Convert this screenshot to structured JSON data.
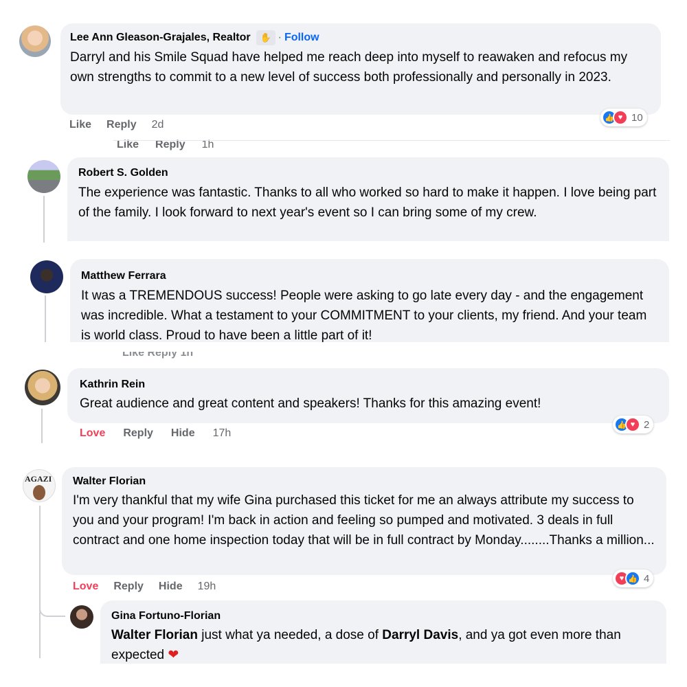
{
  "colors": {
    "like_blue": "#1877f2",
    "love_red": "#f33e58",
    "bubble_bg": "#f0f2f5",
    "follow_blue": "#0866ff"
  },
  "comments": [
    {
      "author": "Lee Ann Gleason-Grajales, Realtor",
      "badge_icon": "top-fan-badge-icon",
      "follow": "Follow",
      "text": "Darryl and his Smile Squad have helped me reach deep into myself to reawaken and refocus my own strengths to commit to a new level of success both professionally and personally in 2023.",
      "actions": {
        "like": "Like",
        "reply": "Reply",
        "time": "2d"
      },
      "reactions": {
        "icons": [
          "like-icon",
          "love-icon"
        ],
        "count": "10"
      },
      "sub_actions": {
        "like": "Like",
        "reply": "Reply",
        "time": "1h"
      }
    },
    {
      "author": "Robert S. Golden",
      "text": "The experience was fantastic. Thanks to all who worked so hard to make it happen. I love being part of the family. I look forward to next year's event so I can bring some of my crew."
    },
    {
      "author": "Matthew Ferrara",
      "text": "It was a TREMENDOUS success! People were asking to go late every day - and the engagement was incredible. What a testament to your COMMITMENT to your clients, my friend. And your team is world class. Proud to have been a little part of it!",
      "partial_actions": "Like Reply 1h"
    },
    {
      "author": "Kathrin Rein",
      "text": "Great audience and great content and speakers! Thanks for this amazing event!",
      "actions": {
        "love": "Love",
        "reply": "Reply",
        "hide": "Hide",
        "time": "17h"
      },
      "reactions": {
        "icons": [
          "like-icon",
          "love-icon"
        ],
        "count": "2"
      }
    },
    {
      "author": "Walter Florian",
      "text": "I'm very thankful that my wife Gina purchased this ticket for me an always attribute my success to you and your program! I'm back in action and feeling so pumped and motivated. 3 deals in full contract and one home inspection today that will be in full contract by Monday........Thanks a million...",
      "actions": {
        "love": "Love",
        "reply": "Reply",
        "hide": "Hide",
        "time": "19h"
      },
      "reactions": {
        "icons": [
          "love-icon",
          "like-icon"
        ],
        "count": "4"
      },
      "avatar_text": "AGAZI"
    },
    {
      "author": "Gina Fortuno-Florian",
      "mention1": "Walter Florian",
      "text1": " just what ya needed, a dose of ",
      "mention2": "Darryl Davis",
      "text2": ", and ya got even more than expected ",
      "emoji_icon": "red-heart-icon"
    }
  ]
}
